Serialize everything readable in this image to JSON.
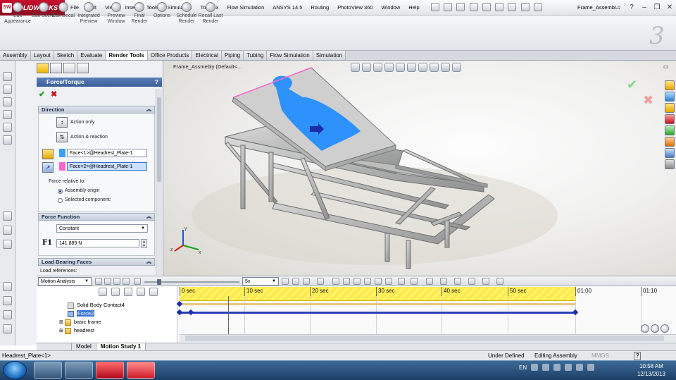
{
  "app": {
    "logo": "SOLIDWORKS",
    "doc_title": "Frame_Assembl...",
    "search_placeholder": ""
  },
  "menu": [
    "File",
    "Edit",
    "View",
    "Insert",
    "Tools",
    "Simulation",
    "Toolbox",
    "Flow Simulation",
    "ANSYS 14.5",
    "Routing",
    "PhotoView 360",
    "Window",
    "Help"
  ],
  "render_cmds": [
    {
      "label": "Edit Appearance"
    },
    {
      "label": "Edit Scene"
    },
    {
      "label": "Edit Decal"
    },
    {
      "label": "Integrated Preview"
    },
    {
      "label": "Preview Window"
    },
    {
      "label": "Final Render"
    },
    {
      "label": "Options"
    },
    {
      "label": "Schedule Render"
    },
    {
      "label": "Recall Last Render"
    }
  ],
  "tabs": [
    "Assembly",
    "Layout",
    "Sketch",
    "Evaluate",
    "Render Tools",
    "Office Products",
    "Electrical",
    "Piping",
    "Tubing",
    "Flow Simulation",
    "Simulation"
  ],
  "active_tab": "Render Tools",
  "pm": {
    "title": "Force/Torque",
    "help": "?",
    "ok": "✔",
    "cancel": "✖",
    "direction": {
      "header": "Direction",
      "action_only": "Action only",
      "action_reaction": "Action & reaction",
      "face1": "Face<1>@Headrest_Plate-1",
      "face2": "Face<2>@Headrest_Plate-1",
      "relative_label": "Force relative to:",
      "opt_origin": "Assembly origin",
      "opt_component": "Selected component:"
    },
    "force_function": {
      "header": "Force Function",
      "type": "Constant",
      "f1_label": "F1",
      "f1_value": "141.889 N"
    },
    "load_faces": {
      "header": "Load Bearing Faces",
      "refs_label": "Load references:"
    }
  },
  "viewport": {
    "title": "Frame_Assmebly  (Default<..."
  },
  "motion": {
    "study_type": "Motion Analysis",
    "speed": "5x",
    "tree": [
      "Solid Body Contact4",
      "Force2",
      "basic frame",
      "headrest"
    ],
    "ticks": [
      "0 sec",
      "10 sec",
      "20 sec",
      "30 sec",
      "40 sec",
      "50 sec",
      "01:00",
      "01:10"
    ]
  },
  "bottom_tabs": [
    "Model",
    "Motion Study 1"
  ],
  "active_bottom_tab": "Motion Study 1",
  "status": {
    "left": "Headrest_Plate<1>",
    "under_defined": "Under Defined",
    "editing": "Editing Assembly",
    "units": "MMGS",
    "help": "?"
  },
  "taskbar": {
    "lang": "EN",
    "time": "10:58 AM",
    "date": "12/13/2013"
  },
  "colors": {
    "accent": "#3b5f98",
    "yellow_band": "#ffe94a",
    "keyframe": "#1a2fa8",
    "face_selection": "#1f8dff",
    "titlebar_red": "#c8102e"
  }
}
